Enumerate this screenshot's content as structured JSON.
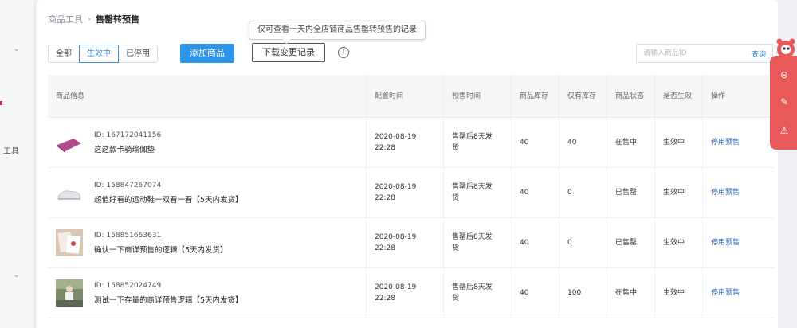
{
  "breadcrumb": {
    "parent": "商品工具",
    "separator": "›",
    "current": "售罄转预售"
  },
  "tabs": [
    {
      "label": "全部",
      "active": false
    },
    {
      "label": "生效中",
      "active": true
    },
    {
      "label": "已停用",
      "active": false
    }
  ],
  "toolbar": {
    "add_label": "添加商品",
    "download_label": "下载变更记录",
    "tooltip": "仅可查看一天内全店铺商品售罄转预售的记录"
  },
  "search": {
    "placeholder": "请输入商品ID",
    "button_label": "查询"
  },
  "table": {
    "headers": [
      "商品信息",
      "配置时间",
      "预售时间",
      "商品库存",
      "仅有库存",
      "商品状态",
      "是否生效",
      "操作"
    ],
    "rows": [
      {
        "id": "ID: 167172041156",
        "name": "这这款卡骑瑜伽垫",
        "config_time_date": "2020-08-19",
        "config_time_clock": "22:28",
        "presale_line1": "售罄后8天发",
        "presale_line2": "货",
        "stock": "40",
        "only_stock": "40",
        "status": "在售中",
        "effective": "生效中",
        "action": "停用预售"
      },
      {
        "id": "ID: 158847267074",
        "name": "超值好看的运动鞋一双看一看【5天内发货】",
        "config_time_date": "2020-08-19",
        "config_time_clock": "22:28",
        "presale_line1": "售罄后8天发",
        "presale_line2": "货",
        "stock": "40",
        "only_stock": "0",
        "status": "已售罄",
        "effective": "生效中",
        "action": "停用预售"
      },
      {
        "id": "ID: 158851663631",
        "name": "确认一下商详预售的逻辑【5天内发货】",
        "config_time_date": "2020-08-19",
        "config_time_clock": "22:28",
        "presale_line1": "售罄后8天发",
        "presale_line2": "货",
        "stock": "40",
        "only_stock": "0",
        "status": "已售罄",
        "effective": "生效中",
        "action": "停用预售"
      },
      {
        "id": "ID: 158852024749",
        "name": "测试一下存量的商详预售逻辑【5天内发货】",
        "config_time_date": "2020-08-19",
        "config_time_clock": "22:28",
        "presale_line1": "售罄后8天发",
        "presale_line2": "货",
        "stock": "40",
        "only_stock": "100",
        "status": "在售中",
        "effective": "生效中",
        "action": "停用预售"
      }
    ]
  },
  "sidebar": {
    "label": "工具"
  },
  "icons": {
    "chevron": "chevron-down-icon",
    "info": "info-icon",
    "panel": [
      "minus-circle-icon",
      "edit-icon",
      "warning-icon"
    ]
  },
  "colors": {
    "primary": "#2d94e8",
    "active_tab": "#3f8ed6",
    "link": "#2d66b3",
    "panel": "#e85a5a"
  }
}
